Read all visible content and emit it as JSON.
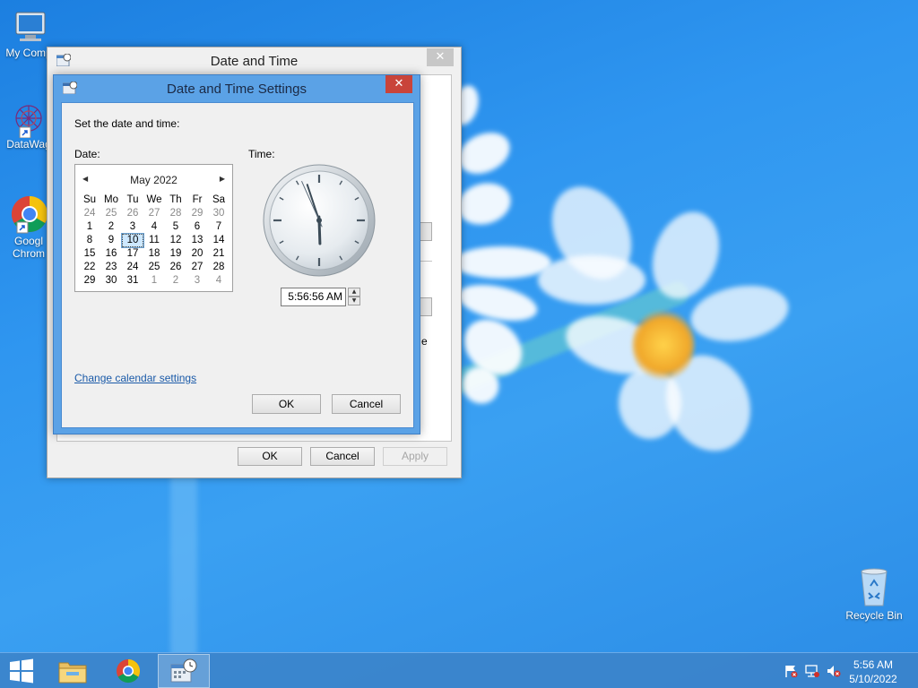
{
  "desktop": {
    "icons": [
      {
        "label": "My Comp",
        "icon": "computer-icon"
      },
      {
        "label": "DataWag",
        "icon": "datawag-icon"
      },
      {
        "label1": "Googl",
        "label2": "Chrom",
        "icon": "chrome-icon"
      },
      {
        "label": "Recycle Bin",
        "icon": "recycle-bin-icon"
      }
    ]
  },
  "back_window": {
    "title": "Date and Time",
    "close_glyph": "✕",
    "buttons": {
      "ok": "OK",
      "cancel": "Cancel",
      "apply": "Apply"
    },
    "clipped_text": "e"
  },
  "dialog": {
    "title": "Date and Time Settings",
    "close_glyph": "✕",
    "instruction": "Set the date and time:",
    "date_label": "Date:",
    "time_label": "Time:",
    "calendar": {
      "month_title": "May 2022",
      "prev_glyph": "◀",
      "next_glyph": "▶",
      "weekdays": [
        "Su",
        "Mo",
        "Tu",
        "We",
        "Th",
        "Fr",
        "Sa"
      ],
      "weeks": [
        [
          "24",
          "25",
          "26",
          "27",
          "28",
          "29",
          "30"
        ],
        [
          "1",
          "2",
          "3",
          "4",
          "5",
          "6",
          "7"
        ],
        [
          "8",
          "9",
          "10",
          "11",
          "12",
          "13",
          "14"
        ],
        [
          "15",
          "16",
          "17",
          "18",
          "19",
          "20",
          "21"
        ],
        [
          "22",
          "23",
          "24",
          "25",
          "26",
          "27",
          "28"
        ],
        [
          "29",
          "30",
          "31",
          "1",
          "2",
          "3",
          "4"
        ]
      ],
      "selected_day": "10"
    },
    "time_value": "5:56:56 AM",
    "clock": {
      "hour": 5,
      "minute": 56,
      "second": 56
    },
    "change_calendar_link": "Change calendar settings",
    "ok": "OK",
    "cancel": "Cancel"
  },
  "taskbar": {
    "time": "5:56 AM",
    "date": "5/10/2022"
  }
}
